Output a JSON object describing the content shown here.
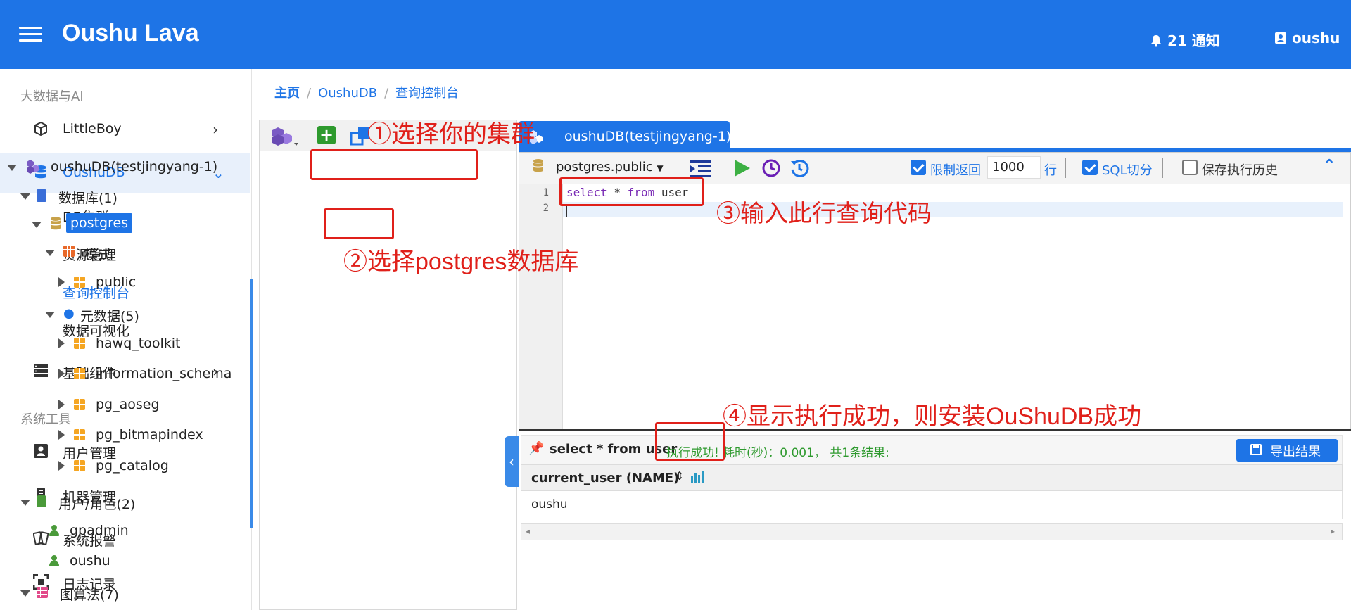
{
  "header": {
    "app_title": "Oushu Lava",
    "notifications": "21 通知",
    "user": "oushu"
  },
  "sidebar": {
    "section_bigdata": "大数据与AI",
    "section_tools": "系统工具",
    "items": {
      "littleboy": "LittleBoy",
      "oushudb": "OushuDB",
      "db_cluster": "DB集群",
      "resource_mgmt": "资源管理",
      "query_console": "查询控制台",
      "data_viz": "数据可视化",
      "base_components": "基础组件",
      "user_mgmt": "用户管理",
      "machine_mgmt": "机器管理",
      "system_alarm": "系统报警",
      "log_records": "日志记录"
    }
  },
  "breadcrumb": {
    "home": "主页",
    "db": "OushuDB",
    "page": "查询控制台"
  },
  "tree": {
    "cluster": "oushuDB(testjingyang-1)",
    "databases": "数据库(1)",
    "postgres": "postgres",
    "schema": "模式",
    "public": "public",
    "metadata": "元数据(5)",
    "meta_items": [
      "hawq_toolkit",
      "information_schema",
      "pg_aoseg",
      "pg_bitmapindex",
      "pg_catalog"
    ],
    "users_roles": "用户/角色(2)",
    "users": [
      "gpadmin",
      "oushu"
    ],
    "graph_algos": "图算法(7)"
  },
  "editor": {
    "tab_label": "oushuDB(testjingyang-1)",
    "schema_select": "postgres.public",
    "limit_label": "限制返回",
    "limit_value": "1000",
    "limit_unit": "行",
    "sql_split_label": "SQL切分",
    "save_history_label": "保存执行历史",
    "line_numbers": [
      "1",
      "2"
    ],
    "code": {
      "kw1": "select",
      "mid": " * ",
      "kw2": "from",
      "tail": " user"
    }
  },
  "result": {
    "query": "select * from user",
    "status": "执行成功!",
    "stats": " 耗时(秒)：0.001， 共1条结果:",
    "export_label": "导出结果",
    "column": "current_user (NAME)",
    "rows": [
      "oushu"
    ]
  },
  "annotations": {
    "step1": "①选择你的集群",
    "step2": "②选择postgres数据库",
    "step3": "③输入此行查询代码",
    "step4": "④显示执行成功，则安装OuShuDB成功"
  },
  "colors": {
    "primary": "#1e74e6",
    "annotation": "#e0201a",
    "success": "#2e9a2e"
  }
}
